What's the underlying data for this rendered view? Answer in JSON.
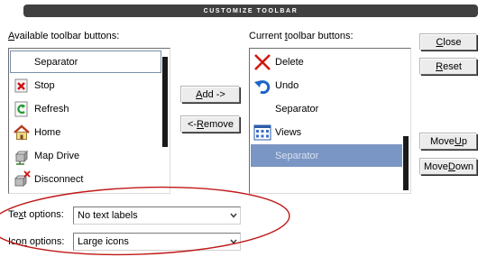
{
  "title": "CUSTOMIZE TOOLBAR",
  "available": {
    "label_pre": "",
    "label_mnemonic": "A",
    "label_post": "vailable toolbar buttons:",
    "items": [
      {
        "label": "Separator",
        "icon": "none"
      },
      {
        "label": "Stop",
        "icon": "stop-icon"
      },
      {
        "label": "Refresh",
        "icon": "refresh-icon"
      },
      {
        "label": "Home",
        "icon": "home-icon"
      },
      {
        "label": "Map Drive",
        "icon": "map-drive-icon"
      },
      {
        "label": "Disconnect",
        "icon": "disconnect-icon"
      }
    ]
  },
  "current": {
    "label_pre": "Current ",
    "label_mnemonic": "t",
    "label_post": "oolbar buttons:",
    "items": [
      {
        "label": "Delete",
        "icon": "delete-icon"
      },
      {
        "label": "Undo",
        "icon": "undo-icon"
      },
      {
        "label": "Separator",
        "icon": "none"
      },
      {
        "label": "Views",
        "icon": "views-icon"
      },
      {
        "label": "Separator",
        "icon": "none",
        "selected": true
      }
    ]
  },
  "buttons": {
    "add": {
      "mnemonic": "A",
      "rest": "dd ->"
    },
    "remove": {
      "pre": "<- ",
      "mnemonic": "R",
      "rest": "emove"
    },
    "close": {
      "mnemonic": "C",
      "rest": "lose"
    },
    "reset": {
      "mnemonic": "R",
      "rest": "eset"
    },
    "move_up": {
      "pre": "Move ",
      "mnemonic": "U",
      "rest": "p"
    },
    "move_down": {
      "pre": "Move ",
      "mnemonic": "D",
      "rest": "own"
    }
  },
  "text_options": {
    "label_pre": "Te",
    "label_mnemonic": "x",
    "label_post": "t options:",
    "value": "No text labels"
  },
  "icon_options": {
    "label_pre": "Ico",
    "label_mnemonic": "n",
    "label_post": " options:",
    "value": "Large icons"
  },
  "colors": {
    "selection": "#7a96c4",
    "annotation": "#c01818",
    "titlebar": "#404040"
  }
}
